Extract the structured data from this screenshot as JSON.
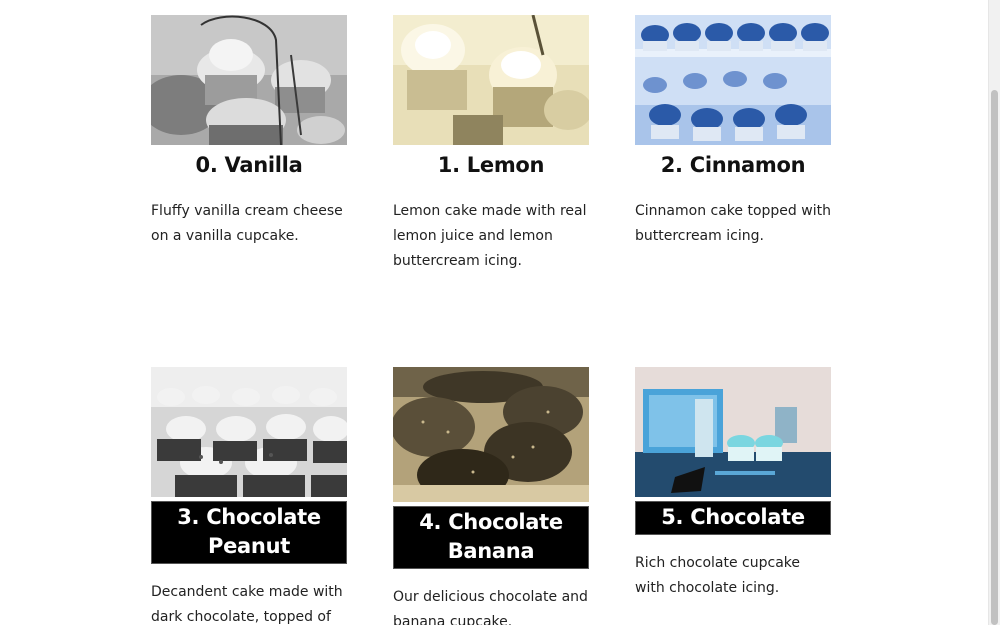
{
  "products": [
    {
      "title": "0. Vanilla",
      "description": "Fluffy vanilla cream cheese on a vanilla cupcake.",
      "image": "vanilla-cupcake-image"
    },
    {
      "title": "1. Lemon",
      "description": "Lemon cake made with real lemon juice and lemon buttercream icing.",
      "image": "lemon-cupcake-image"
    },
    {
      "title": "2. Cinnamon",
      "description": "Cinnamon cake topped with buttercream icing.",
      "image": "cinnamon-cupcake-image"
    },
    {
      "title": "3. Chocolate Peanut",
      "description": "Decandent cake made with dark chocolate, topped of",
      "image": "chocolate-peanut-cupcake-image"
    },
    {
      "title": "4. Chocolate Banana",
      "description": "Our delicious chocolate and banana cupcake.",
      "image": "chocolate-banana-cupcake-image"
    },
    {
      "title": "5. Chocolate",
      "description": "Rich chocolate cupcake with chocolate icing.",
      "image": "chocolate-cupcake-image"
    }
  ]
}
